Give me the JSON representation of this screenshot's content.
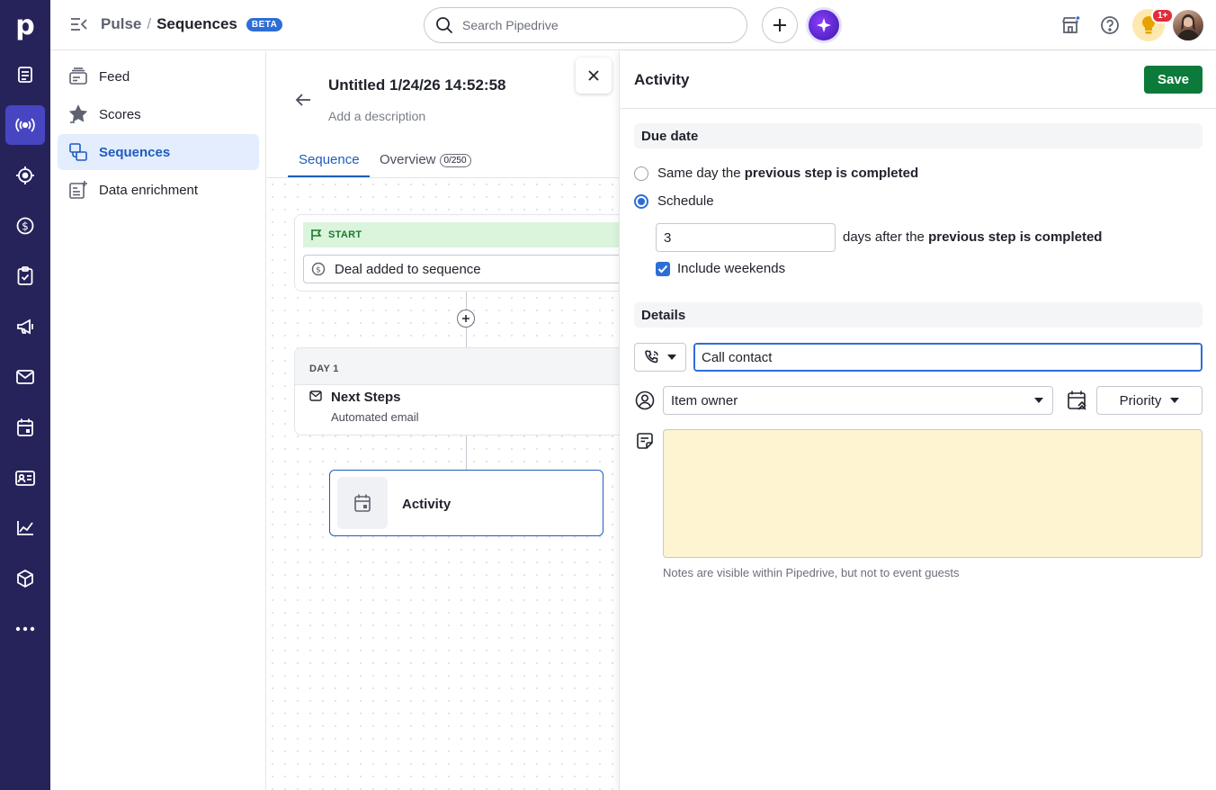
{
  "app": {
    "logo_letter": "p"
  },
  "rail": {
    "icons": [
      "leads-icon",
      "pulse-icon",
      "target-icon",
      "deals-icon",
      "tasks-icon",
      "campaigns-icon",
      "mail-icon",
      "calendar-icon",
      "contacts-icon",
      "insights-icon",
      "products-icon",
      "more-icon"
    ],
    "active": "pulse-icon"
  },
  "header": {
    "crumb_parent": "Pulse",
    "crumb_sep": "/",
    "crumb_current": "Sequences",
    "badge": "BETA",
    "search_placeholder": "Search Pipedrive",
    "notification_count": "1+"
  },
  "sidebar": {
    "items": [
      {
        "label": "Feed",
        "icon": "feed-icon"
      },
      {
        "label": "Scores",
        "icon": "scores-icon"
      },
      {
        "label": "Sequences",
        "icon": "sequences-icon",
        "active": true
      },
      {
        "label": "Data enrichment",
        "icon": "data-enrichment-icon"
      }
    ]
  },
  "sequence": {
    "title": "Untitled 1/24/26 14:52:58",
    "description_placeholder": "Add a description",
    "tabs": [
      {
        "label": "Sequence",
        "active": true
      },
      {
        "label": "Overview",
        "count": "0/250"
      }
    ],
    "start_label": "START",
    "trigger": "Deal added to sequence",
    "day_label": "DAY 1",
    "step_title": "Next Steps",
    "step_subtitle": "Automated email",
    "activity_label": "Activity"
  },
  "panel": {
    "title": "Activity",
    "save_label": "Save",
    "due_date_heading": "Due date",
    "option_same_day_prefix": "Same day the ",
    "option_same_day_bold": "previous step is completed",
    "option_schedule": "Schedule",
    "days_value": "3",
    "days_text_prefix": "days after the ",
    "days_text_bold": "previous step is completed",
    "include_weekends": "Include weekends",
    "details_heading": "Details",
    "subject_value": "Call contact",
    "owner_value": "Item owner",
    "priority_label": "Priority",
    "notes_hint": "Notes are visible within Pipedrive, but not to event guests"
  },
  "colors": {
    "rail_bg": "#26235a",
    "rail_active": "#4845c2",
    "accent": "#1f5cbf",
    "save": "#0c7a3a",
    "notes_bg": "#fff4d1",
    "start_bg": "#dbf4dc"
  }
}
